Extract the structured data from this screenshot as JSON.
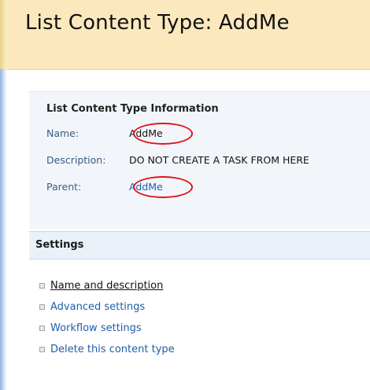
{
  "page": {
    "title": "List Content Type: AddMe"
  },
  "info": {
    "heading": "List Content Type Information",
    "name_label": "Name:",
    "name_value": "AddMe",
    "description_label": "Description:",
    "description_value": "DO NOT CREATE A TASK FROM HERE",
    "parent_label": "Parent:",
    "parent_value": "AddMe"
  },
  "settings": {
    "title": "Settings",
    "items": [
      {
        "label": "Name and description"
      },
      {
        "label": "Advanced settings"
      },
      {
        "label": "Workflow settings"
      },
      {
        "label": "Delete this content type"
      }
    ]
  },
  "colors": {
    "title_bar_bg": "#fbe9bd",
    "link": "#1f5ea8",
    "highlight_circle": "#e0141b"
  },
  "icons": {
    "bullet": "bullet-square-icon"
  }
}
